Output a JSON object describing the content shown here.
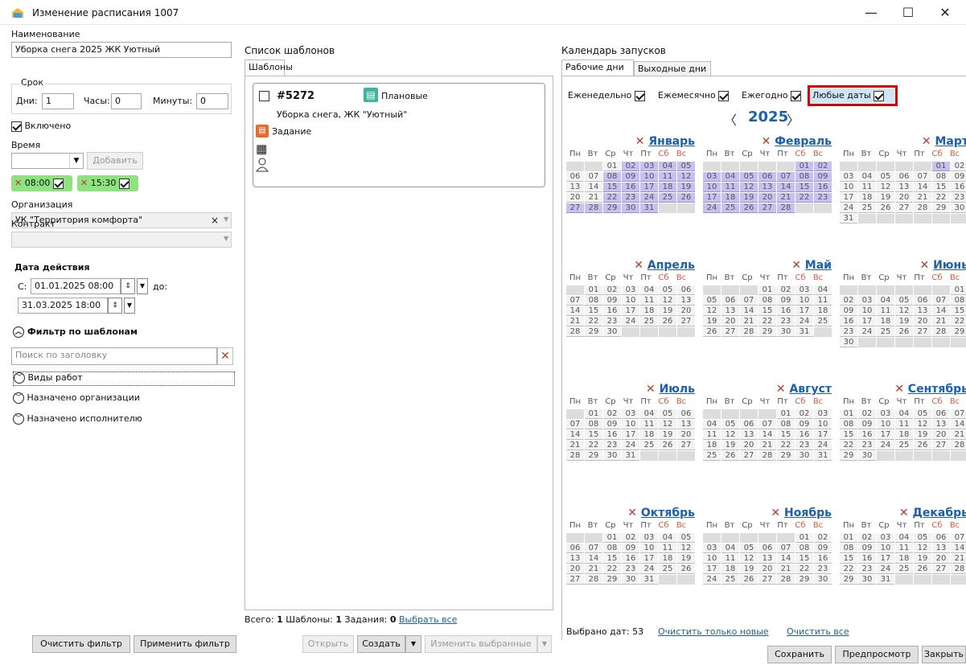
{
  "window": {
    "title": "Изменение расписания 1007",
    "min": "—",
    "max": "☐",
    "close": "✕"
  },
  "left": {
    "name_label": "Наименование",
    "name_value": "Уборка снега 2025 ЖК Уютный",
    "term_label": "Срок",
    "days_label": "Дни:",
    "days_value": "1",
    "hours_label": "Часы:",
    "hours_value": "0",
    "minutes_label": "Минуты:",
    "minutes_value": "0",
    "enabled_label": "Включено",
    "time_label": "Время",
    "add_label": "Добавить",
    "times": [
      "08:00",
      "15:30"
    ],
    "org_label": "Организация",
    "org_value": "УК \"Территория комфорта\"",
    "org_clear": "×",
    "contract_label": "Контракт",
    "date_label": "Дата действия",
    "from_label": "С:",
    "from_value": "01.01.2025 08:00",
    "to_label": "до:",
    "to_value": "31.03.2025 18:00",
    "filter_label": "Фильтр по шаблонам",
    "search_placeholder": "Поиск по заголовку",
    "expanders": [
      "Виды работ",
      "Назначено организации",
      "Назначено исполнителю"
    ],
    "clear_filter": "Очистить фильтр",
    "apply_filter": "Применить фильтр"
  },
  "middle": {
    "title": "Список шаблонов",
    "tab": "Шаблоны",
    "card": {
      "id": "#5272",
      "category": "Плановые",
      "name": "Уборка снега, ЖК \"Уютный\"",
      "type": "Задание"
    },
    "summary_a": "Всего: ",
    "summary_b": "1",
    "summary_c": " Шаблоны: ",
    "summary_d": "1",
    "summary_e": " Задания: ",
    "summary_f": "0",
    "select_all": "Выбрать все",
    "open": "Открыть",
    "create": "Создать",
    "change_selected": "Изменить выбранные"
  },
  "right": {
    "title": "Календарь запусков",
    "tabs": [
      "Рабочие дни",
      "Выходные дни"
    ],
    "filters": [
      "Еженедельно",
      "Ежемесячно",
      "Ежегодно",
      "Любые даты"
    ],
    "year": "2025",
    "prev": "〈",
    "next": "〉",
    "weekdays": [
      "Пн",
      "Вт",
      "Ср",
      "Чт",
      "Пт",
      "Сб",
      "Вс"
    ],
    "months": [
      {
        "name": "Январь",
        "offset": 2,
        "days": 31,
        "selected": [
          2,
          3,
          4,
          5,
          8,
          9,
          10,
          11,
          12,
          15,
          16,
          17,
          18,
          19,
          22,
          23,
          24,
          25,
          26,
          27,
          28,
          29,
          30,
          31
        ]
      },
      {
        "name": "Февраль",
        "offset": 5,
        "days": 28,
        "selected": [
          1,
          2,
          3,
          4,
          5,
          6,
          7,
          8,
          9,
          10,
          11,
          12,
          13,
          14,
          15,
          16,
          17,
          18,
          19,
          20,
          21,
          22,
          23,
          24,
          25,
          26,
          27,
          28
        ]
      },
      {
        "name": "Март",
        "offset": 5,
        "days": 31,
        "selected": [
          1
        ]
      },
      {
        "name": "Апрель",
        "offset": 1,
        "days": 30,
        "selected": []
      },
      {
        "name": "Май",
        "offset": 3,
        "days": 31,
        "selected": []
      },
      {
        "name": "Июнь",
        "offset": 6,
        "days": 30,
        "selected": []
      },
      {
        "name": "Июль",
        "offset": 1,
        "days": 31,
        "selected": []
      },
      {
        "name": "Август",
        "offset": 4,
        "days": 31,
        "selected": []
      },
      {
        "name": "Сентябрь",
        "offset": 0,
        "days": 30,
        "selected": []
      },
      {
        "name": "Октябрь",
        "offset": 2,
        "days": 31,
        "selected": []
      },
      {
        "name": "Ноябрь",
        "offset": 5,
        "days": 30,
        "selected": []
      },
      {
        "name": "Декабрь",
        "offset": 0,
        "days": 31,
        "selected": []
      }
    ],
    "selected_count": "Выбрано дат: 53",
    "clear_new": "Очистить только новые",
    "clear_all": "Очистить все"
  },
  "footer": {
    "save": "Сохранить",
    "preview": "Предпросмотр",
    "close": "Закрыть"
  },
  "colors": {
    "selected_day": "#c8c0f0",
    "chip": "#8ee27f",
    "highlight_border": "#e00000",
    "link": "#1a5fb4"
  }
}
